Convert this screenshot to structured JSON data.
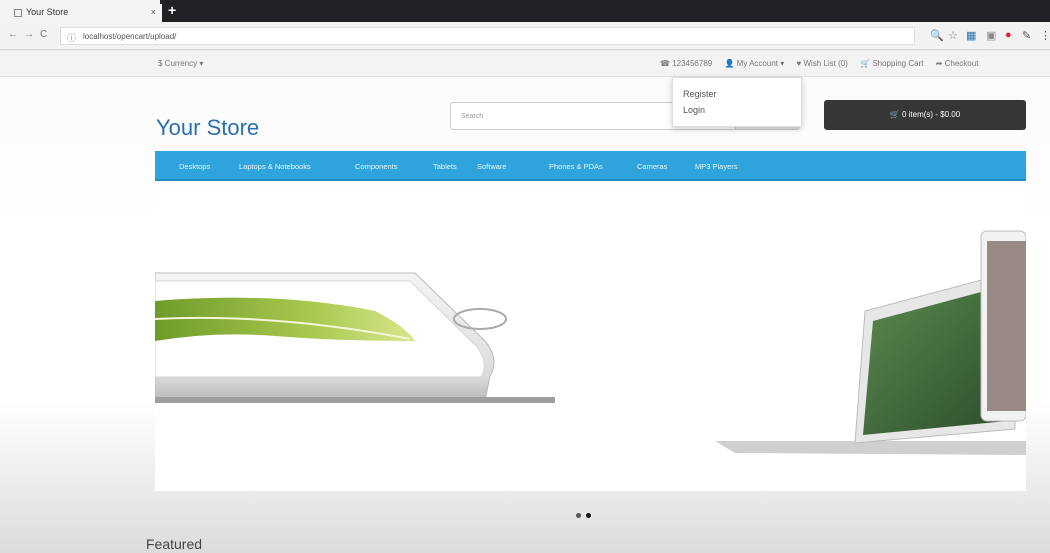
{
  "browser": {
    "tab_title": "Your Store",
    "tab_close": "×",
    "new_tab": "+",
    "url": "localhost/opencart/upload/",
    "nav_icons": [
      "←",
      "→",
      "C"
    ]
  },
  "store": {
    "currency_label": "$ Currency ▾",
    "top_links": {
      "phone": "☎ 123456789",
      "account": "👤 My Account ▾",
      "wishlist": "♥ Wish List (0)",
      "shopping_cart": "🛒 Shopping Cart",
      "checkout": "➦ Checkout"
    },
    "account_menu": [
      "Register",
      "Login"
    ],
    "logo": "Your Store",
    "search_placeholder": "Search",
    "cart_button": "🛒 0 item(s) - $0.00",
    "menu": [
      "Desktops",
      "Laptops & Notebooks",
      "Components",
      "Tablets",
      "Software",
      "Phones & PDAs",
      "Cameras",
      "MP3 Players"
    ],
    "slider_dots": 2,
    "section_title": "Featured"
  },
  "colors": {
    "menu_bg": "#2fa3dc",
    "logo": "#2a6fb0",
    "cart_bg": "#363636"
  }
}
